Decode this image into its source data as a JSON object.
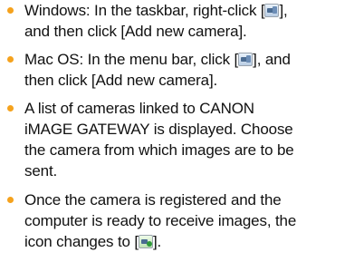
{
  "bullet_color": "#f5a21d",
  "items": [
    {
      "line1_pre": "Windows: In the taskbar, right-click [",
      "line1_icon": "camera-connection-icon",
      "line1_post": "],",
      "line2": "and then click [Add new camera]."
    },
    {
      "line1_pre": "Mac OS: In the menu bar, click [",
      "line1_icon": "camera-connection-icon",
      "line1_post": "], and",
      "line2": "then click [Add new camera]."
    },
    {
      "line1": "A list of cameras linked to CANON",
      "line2": "iMAGE GATEWAY is displayed. Choose",
      "line3": "the camera from which images are to be",
      "line4": "sent."
    },
    {
      "line1": "Once the camera is registered and the",
      "line2": "computer is ready to receive images, the",
      "line3_pre": "icon changes to [",
      "line3_icon": "camera-ready-icon",
      "line3_post": "]."
    }
  ]
}
